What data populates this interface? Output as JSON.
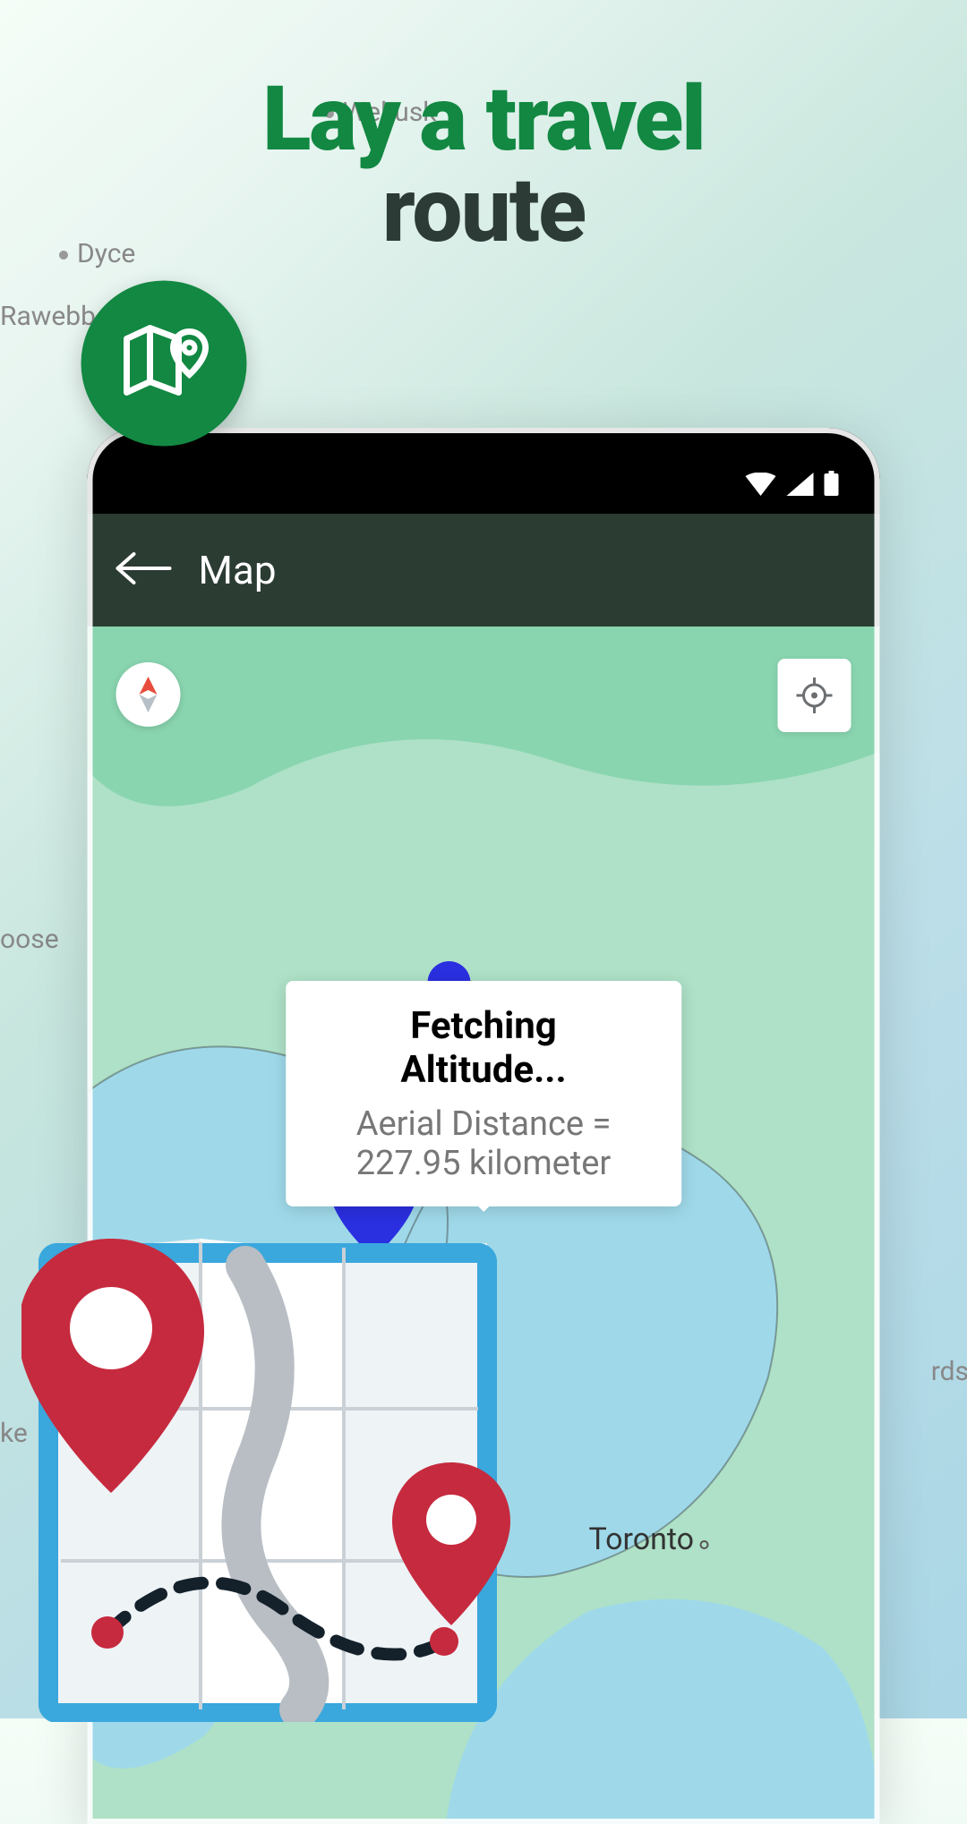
{
  "hero": {
    "line1": "Lay a travel",
    "line2": "route"
  },
  "bg_labels": {
    "wekusk": "Wekusk",
    "dyce": "Dyce",
    "rawebb": "Rawebb",
    "oose": "oose",
    "ke": "ke",
    "rds": "rds"
  },
  "phone": {
    "app_bar_title": "Map",
    "info_title": "Fetching Altitude...",
    "info_sub": "Aerial Distance = 227.95 kilometer",
    "city_label": "Toronto"
  },
  "colors": {
    "brand_green": "#128842",
    "appbar_green": "#2b3c33",
    "marker_blue": "#2a2fe0",
    "pin_red": "#c62a3e"
  }
}
